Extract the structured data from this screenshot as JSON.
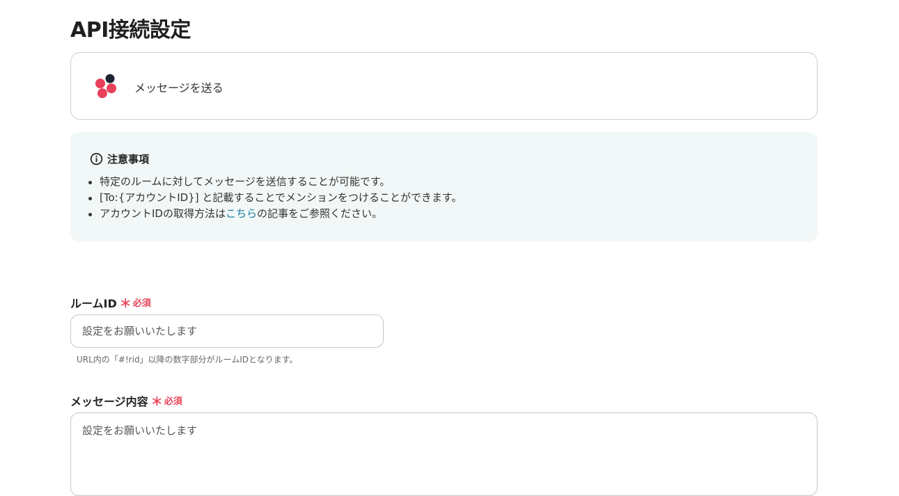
{
  "page": {
    "title": "API接続設定"
  },
  "action": {
    "label": "メッセージを送る",
    "logo_icon": "chatwork-logo",
    "logo_colors": [
      "#1c2333",
      "#e8405a"
    ]
  },
  "notice": {
    "icon": "info-circle-icon",
    "title": "注意事項",
    "items": [
      {
        "text": "特定のルームに対してメッセージを送信することが可能です。"
      },
      {
        "text": "[To:{アカウントID}] と記載することでメンションをつけることができます。"
      },
      {
        "before": "アカウントIDの取得方法は",
        "link": "こちら",
        "after": "の記事をご参照ください。"
      }
    ],
    "background": "#f1f8f7",
    "link_color": "#1a7a9c"
  },
  "fields": {
    "room_id": {
      "label": "ルームID",
      "required_mark": "＊",
      "required_text": "必須",
      "placeholder": "設定をお願いいたします",
      "hint": "URL内の「#!rid」以降の数字部分がルームIDとなります。"
    },
    "message": {
      "label": "メッセージ内容",
      "required_mark": "＊",
      "required_text": "必須",
      "placeholder": "設定をお願いいたします"
    }
  },
  "colors": {
    "required": "#e8455a"
  }
}
